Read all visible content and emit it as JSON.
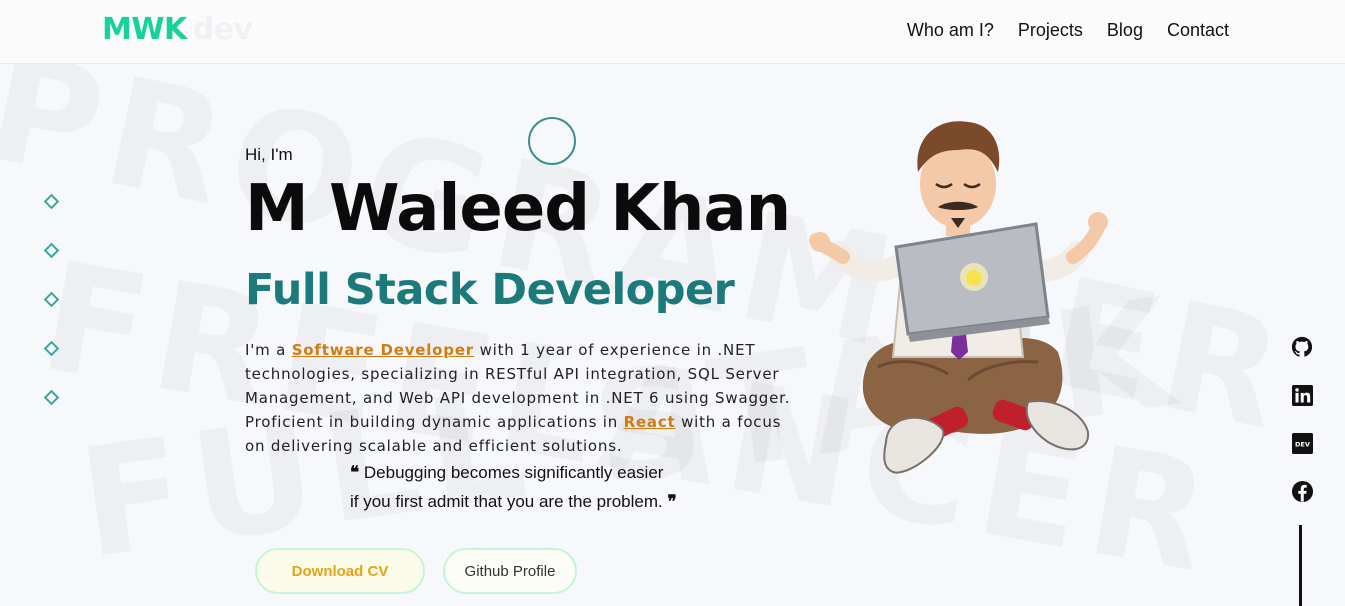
{
  "logo": {
    "part1": "MWK",
    "part2": "dev"
  },
  "nav": [
    "Who am I?",
    "Projects",
    "Blog",
    "Contact"
  ],
  "background_words": [
    "PROGRAMMER",
    "FREELANCER",
    "FULL STACK"
  ],
  "hero": {
    "greeting": "Hi, I'm",
    "name": "M Waleed Khan",
    "role": "Full Stack Developer",
    "bio": {
      "part1": "I'm a ",
      "highlight1": "Software Developer",
      "part2": " with 1 year of experience in .NET technologies, specializing in RESTful API integration, SQL Server Management, and Web API development in .NET 6 using Swagger. Proficient in building dynamic applications in ",
      "highlight2": "React",
      "part3": " with a focus on delivering scalable and efficient solutions."
    },
    "quote": {
      "open_mark": "❝",
      "line1": "Debugging becomes significantly easier",
      "line2": "if you first admit that you are the problem.",
      "close_mark": "❞"
    }
  },
  "buttons": {
    "download_cv": "Download CV",
    "github_profile": "Github Profile"
  },
  "socials": [
    "github-icon",
    "linkedin-icon",
    "dev-icon",
    "facebook-icon"
  ],
  "colors": {
    "accent": "#17d29a",
    "role": "#1d7a7a",
    "highlight": "#d27b12",
    "cv_text": "#e4a514"
  }
}
